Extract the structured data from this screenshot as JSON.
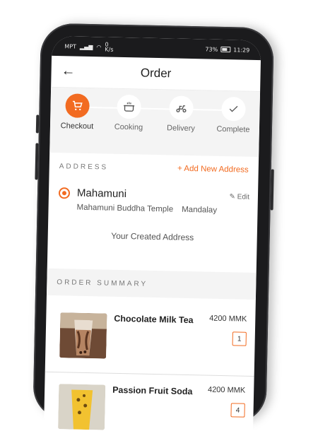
{
  "status_bar": {
    "carrier": "MPT",
    "net_speed": "0\nK/s",
    "battery": "73%",
    "time": "11:29"
  },
  "header": {
    "title": "Order",
    "back_icon": "arrow-left-icon"
  },
  "steps": [
    {
      "label": "Checkout",
      "icon": "cart-icon",
      "active": true
    },
    {
      "label": "Cooking",
      "icon": "pot-icon",
      "active": false
    },
    {
      "label": "Delivery",
      "icon": "scooter-icon",
      "active": false
    },
    {
      "label": "Complete",
      "icon": "check-icon",
      "active": false
    }
  ],
  "address": {
    "section_title": "ADDRESS",
    "add_label": "+ Add New Address",
    "name": "Mahamuni",
    "edit_label": "✎ Edit",
    "detail_place": "Mahamuni Buddha Temple",
    "detail_city": "Mandalay",
    "created_label": "Your Created Address"
  },
  "summary": {
    "section_title": "ORDER SUMMARY",
    "items": [
      {
        "name": "Chocolate Milk Tea",
        "price": "4200 MMK",
        "qty": "1"
      },
      {
        "name": "Passion Fruit Soda",
        "price": "4200 MMK",
        "qty": "4"
      }
    ]
  },
  "colors": {
    "accent": "#f26b21",
    "phone": "#1b1b1d"
  }
}
